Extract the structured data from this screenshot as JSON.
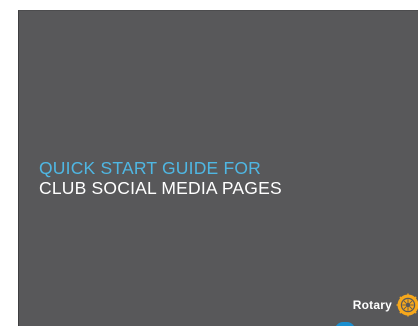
{
  "cover": {
    "title_line_1": "QUICK START GUIDE FOR",
    "title_line_2": "CLUB SOCIAL MEDIA PAGES",
    "brand_text": "Rotary",
    "brand_icon": "rotary-wheel-icon"
  },
  "colors": {
    "background": "#58585a",
    "title_accent": "#4fb7e3",
    "title_main": "#ffffff",
    "brand_gold": "#f7a81b",
    "footer_blue": "#1a8fd0"
  }
}
